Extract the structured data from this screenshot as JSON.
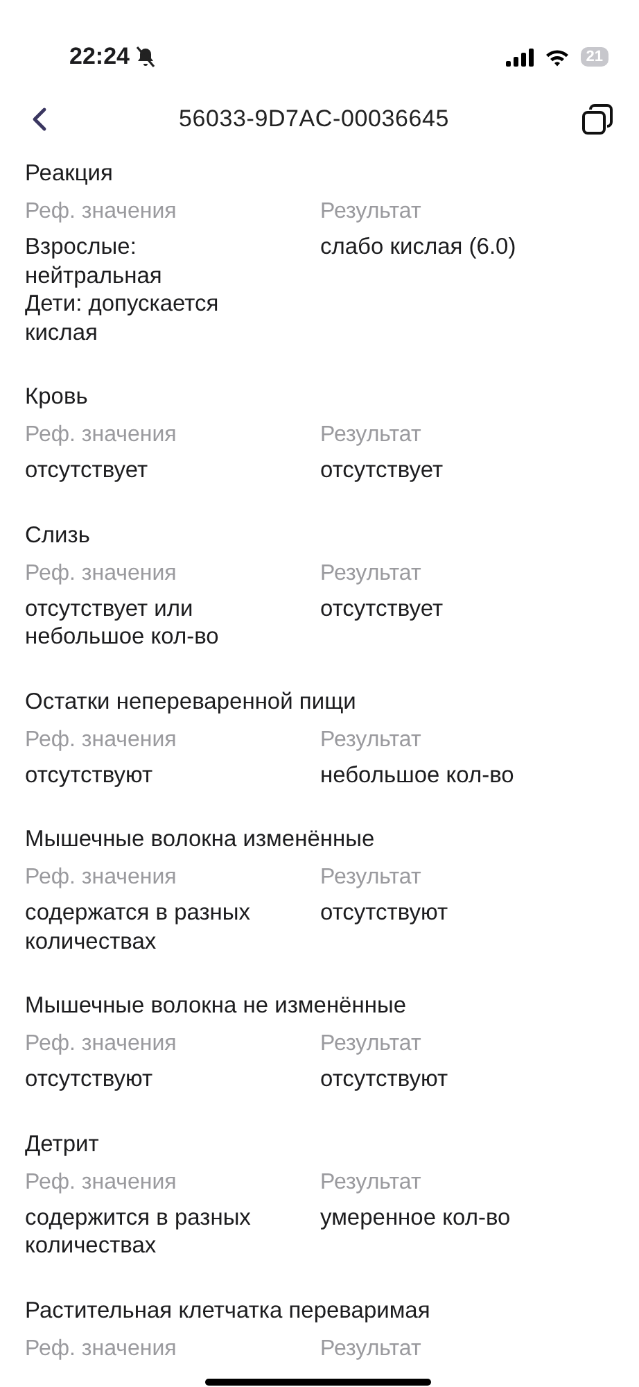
{
  "status_bar": {
    "time": "22:24",
    "silent": true,
    "battery": "21"
  },
  "header": {
    "title": "56033-9D7AC-00036645"
  },
  "sections": [
    {
      "title": "Реакция",
      "ref_label": "Реф. значения",
      "result_label": "Результат",
      "ref_value": "Взрослые: нейтральная\nДети: допускается кислая",
      "result_value": "слабо кислая (6.0)"
    },
    {
      "title": "Кровь",
      "ref_label": "Реф. значения",
      "result_label": "Результат",
      "ref_value": "отсутствует",
      "result_value": "отсутствует"
    },
    {
      "title": "Слизь",
      "ref_label": "Реф. значения",
      "result_label": "Результат",
      "ref_value": "отсутствует или небольшое кол-во",
      "result_value": "отсутствует"
    },
    {
      "title": "Остатки непереваренной пищи",
      "ref_label": "Реф. значения",
      "result_label": "Результат",
      "ref_value": "отсутствуют",
      "result_value": "небольшое кол-во"
    },
    {
      "title": "Мышечные волокна изменённые",
      "ref_label": "Реф. значения",
      "result_label": "Результат",
      "ref_value": "содержатся в разных количествах",
      "result_value": "отсутствуют"
    },
    {
      "title": "Мышечные волокна не изменённые",
      "ref_label": "Реф. значения",
      "result_label": "Результат",
      "ref_value": "отсутствуют",
      "result_value": "отсутствуют"
    },
    {
      "title": "Детрит",
      "ref_label": "Реф. значения",
      "result_label": "Результат",
      "ref_value": "содержится в разных количествах",
      "result_value": "умеренное кол-во"
    },
    {
      "title": "Растительная клетчатка переваримая",
      "ref_label": "Реф. значения",
      "result_label": "Результат"
    }
  ]
}
